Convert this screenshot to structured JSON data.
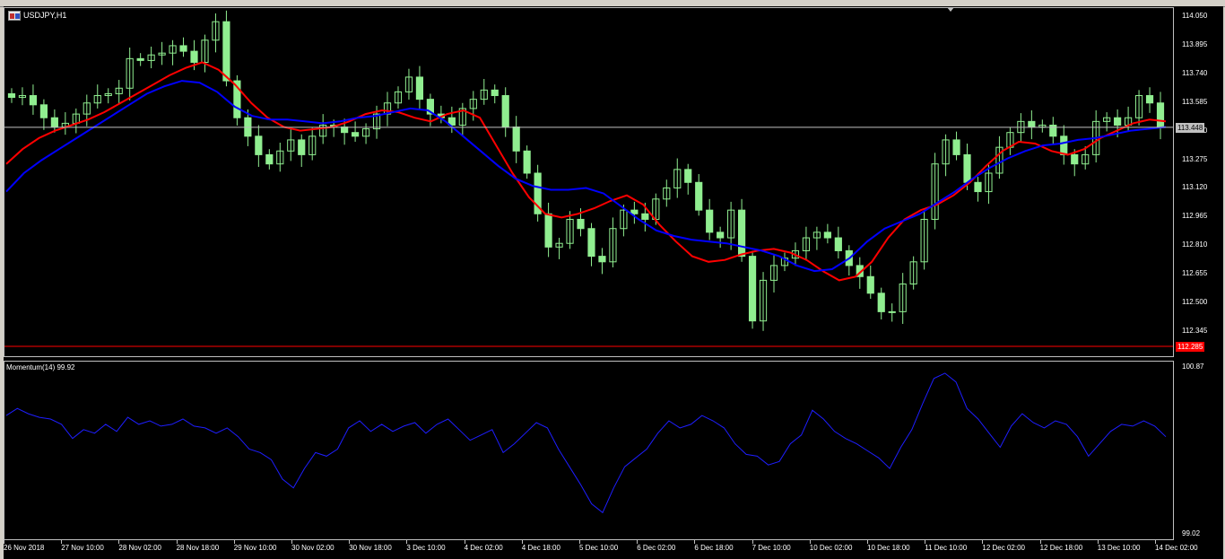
{
  "window": {
    "title": "USDJPY,H1",
    "symbol_icon": "chart-window-icon"
  },
  "indicator": {
    "title": "Momentum(14) 99.92",
    "y_max_label": "100.87",
    "y_min_label": "99.02"
  },
  "price_axis": {
    "ticks": [
      "114.050",
      "113.895",
      "113.740",
      "113.585",
      "113.430",
      "113.275",
      "113.120",
      "112.965",
      "112.810",
      "112.655",
      "112.500",
      "112.345"
    ],
    "current_bid": "113.448",
    "current_bid_value": 113.448,
    "low_marker": "112.285",
    "low_marker_value": 112.285
  },
  "time_axis": {
    "labels": [
      "26 Nov 2018",
      "27 Nov 10:00",
      "28 Nov 02:00",
      "28 Nov 18:00",
      "29 Nov 10:00",
      "30 Nov 02:00",
      "30 Nov 18:00",
      "3 Dec 10:00",
      "4 Dec 02:00",
      "4 Dec 18:00",
      "5 Dec 10:00",
      "6 Dec 02:00",
      "6 Dec 18:00",
      "7 Dec 10:00",
      "10 Dec 02:00",
      "10 Dec 18:00",
      "11 Dec 10:00",
      "12 Dec 02:00",
      "12 Dec 18:00",
      "13 Dec 10:00",
      "14 Dec 02:00"
    ]
  },
  "colors": {
    "background": "#000000",
    "candles": "#90ee90",
    "ma_fast": "#ff0000",
    "ma_slow": "#0000ff",
    "momentum": "#1e1eff",
    "bid_line": "#c0c0c0",
    "low_line": "#ff0000"
  },
  "chart_data": [
    {
      "type": "line",
      "title": "USDJPY,H1",
      "description_series": [
        "price_close",
        "ma_fast",
        "ma_slow"
      ],
      "ylim": [
        112.285,
        114.05
      ],
      "x_range_labels": [
        "26 Nov 2018",
        "14 Dec 02:00"
      ],
      "series": [
        {
          "name": "",
          "color": "#90ee90",
          "values": [
            113.61,
            113.62,
            113.57,
            113.5,
            113.45,
            113.47,
            113.52,
            113.58,
            113.62,
            113.63,
            113.66,
            113.82,
            113.81,
            113.84,
            113.85,
            113.89,
            113.86,
            113.8,
            113.92,
            114.02,
            113.7,
            113.5,
            113.4,
            113.3,
            113.25,
            113.32,
            113.38,
            113.3,
            113.4,
            113.46,
            113.45,
            113.42,
            113.4,
            113.44,
            113.52,
            113.58,
            113.64,
            113.72,
            113.6,
            113.52,
            113.5,
            113.46,
            113.55,
            113.6,
            113.65,
            113.62,
            113.45,
            113.32,
            113.2,
            112.98,
            112.8,
            112.82,
            112.95,
            112.9,
            112.75,
            112.72,
            112.9,
            113.0,
            112.98,
            112.95,
            113.06,
            113.12,
            113.22,
            113.15,
            113.0,
            112.88,
            112.85,
            113.0,
            112.75,
            112.4,
            112.62,
            112.7,
            112.74,
            112.78,
            112.85,
            112.88,
            112.85,
            112.78,
            112.7,
            112.64,
            112.55,
            112.45,
            112.45,
            112.6,
            112.72,
            112.95,
            113.25,
            113.38,
            113.3,
            113.15,
            113.1,
            113.2,
            113.34,
            113.42,
            113.48,
            113.45,
            113.46,
            113.4,
            113.3,
            113.25,
            113.3,
            113.48,
            113.5,
            113.46,
            113.5,
            113.62,
            113.58,
            113.45
          ]
        },
        {
          "name": "",
          "color": "#ff0000",
          "values": [
            113.25,
            113.33,
            113.39,
            113.43,
            113.46,
            113.49,
            113.53,
            113.58,
            113.63,
            113.68,
            113.73,
            113.77,
            113.8,
            113.76,
            113.68,
            113.58,
            113.5,
            113.45,
            113.43,
            113.44,
            113.45,
            113.48,
            113.52,
            113.54,
            113.53,
            113.5,
            113.48,
            113.52,
            113.54,
            113.5,
            113.35,
            113.2,
            113.07,
            112.98,
            112.96,
            112.98,
            113.01,
            113.05,
            113.08,
            113.03,
            112.92,
            112.83,
            112.75,
            112.72,
            112.73,
            112.76,
            112.78,
            112.79,
            112.77,
            112.73,
            112.67,
            112.62,
            112.64,
            112.72,
            112.85,
            112.95,
            113.0,
            113.03,
            113.08,
            113.15,
            113.24,
            113.32,
            113.37,
            113.36,
            113.32,
            113.3,
            113.33,
            113.39,
            113.43,
            113.47,
            113.49,
            113.48
          ]
        },
        {
          "name": "",
          "color": "#0000ff",
          "values": [
            113.1,
            113.2,
            113.27,
            113.33,
            113.39,
            113.45,
            113.51,
            113.57,
            113.63,
            113.67,
            113.7,
            113.69,
            113.64,
            113.56,
            113.51,
            113.49,
            113.49,
            113.48,
            113.47,
            113.48,
            113.5,
            113.51,
            113.53,
            113.55,
            113.54,
            113.48,
            113.4,
            113.32,
            113.24,
            113.17,
            113.13,
            113.11,
            113.11,
            113.12,
            113.09,
            113.02,
            112.95,
            112.89,
            112.86,
            112.84,
            112.83,
            112.82,
            112.8,
            112.78,
            112.75,
            112.7,
            112.67,
            112.68,
            112.74,
            112.83,
            112.9,
            112.94,
            112.98,
            113.04,
            113.1,
            113.17,
            113.23,
            113.28,
            113.32,
            113.35,
            113.36,
            113.38,
            113.39,
            113.41,
            113.43,
            113.44,
            113.45
          ]
        }
      ]
    },
    {
      "type": "line",
      "title": "Momentum(14) 99.92",
      "ylim": [
        99.02,
        100.87
      ],
      "series": [
        {
          "name": "Momentum(14)",
          "color": "#1e1eff",
          "values": [
            100.32,
            100.4,
            100.34,
            100.3,
            100.28,
            100.22,
            100.06,
            100.16,
            100.12,
            100.22,
            100.14,
            100.3,
            100.22,
            100.26,
            100.2,
            100.22,
            100.28,
            100.2,
            100.18,
            100.12,
            100.18,
            100.08,
            99.94,
            99.9,
            99.82,
            99.6,
            99.5,
            99.72,
            99.9,
            99.86,
            99.94,
            100.18,
            100.26,
            100.14,
            100.22,
            100.14,
            100.2,
            100.24,
            100.12,
            100.22,
            100.28,
            100.16,
            100.04,
            100.1,
            100.16,
            99.9,
            100.0,
            100.12,
            100.24,
            100.18,
            99.94,
            99.74,
            99.54,
            99.32,
            99.22,
            99.5,
            99.74,
            99.84,
            99.94,
            100.12,
            100.26,
            100.18,
            100.22,
            100.32,
            100.26,
            100.18,
            100.0,
            99.88,
            99.86,
            99.76,
            99.8,
            100.0,
            100.1,
            100.38,
            100.28,
            100.14,
            100.06,
            100.0,
            99.92,
            99.84,
            99.72,
            99.96,
            100.16,
            100.46,
            100.74,
            100.8,
            100.7,
            100.4,
            100.28,
            100.12,
            99.96,
            100.2,
            100.34,
            100.24,
            100.18,
            100.26,
            100.22,
            100.08,
            99.86,
            100.0,
            100.14,
            100.22,
            100.2,
            100.26,
            100.2,
            100.08
          ]
        }
      ]
    }
  ]
}
